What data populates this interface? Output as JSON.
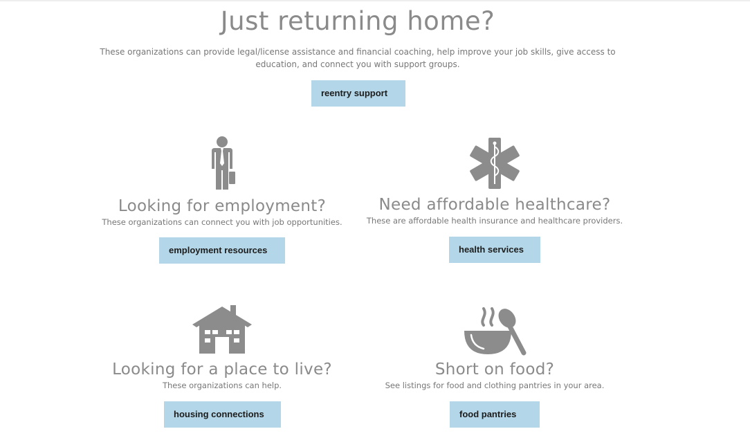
{
  "hero": {
    "title": "Just returning home?",
    "description": "These organizations can provide legal/license assistance and financial coaching, help improve your job skills, give access to education, and connect you with support groups.",
    "button_label": "reentry support"
  },
  "sections": {
    "employment": {
      "icon": "businessman-icon",
      "title": "Looking for employment?",
      "description": "These organizations can connect you with job opportunities.",
      "button_label": "employment resources"
    },
    "healthcare": {
      "icon": "star-of-life-icon",
      "title": "Need affordable healthcare?",
      "description": "These are affordable health insurance and healthcare providers.",
      "button_label": "health services"
    },
    "housing": {
      "icon": "house-icon",
      "title": "Looking for a place to live?",
      "description": "These organizations can help.",
      "button_label": "housing connections"
    },
    "food": {
      "icon": "food-bowl-icon",
      "title": "Short on food?",
      "description": "See listings for food and clothing pantries in your area.",
      "button_label": "food pantries"
    }
  },
  "colors": {
    "button_bg": "#b3d7e8",
    "heading": "#8a8a8a",
    "icon": "#8c8c8c",
    "body_text": "#777777"
  }
}
